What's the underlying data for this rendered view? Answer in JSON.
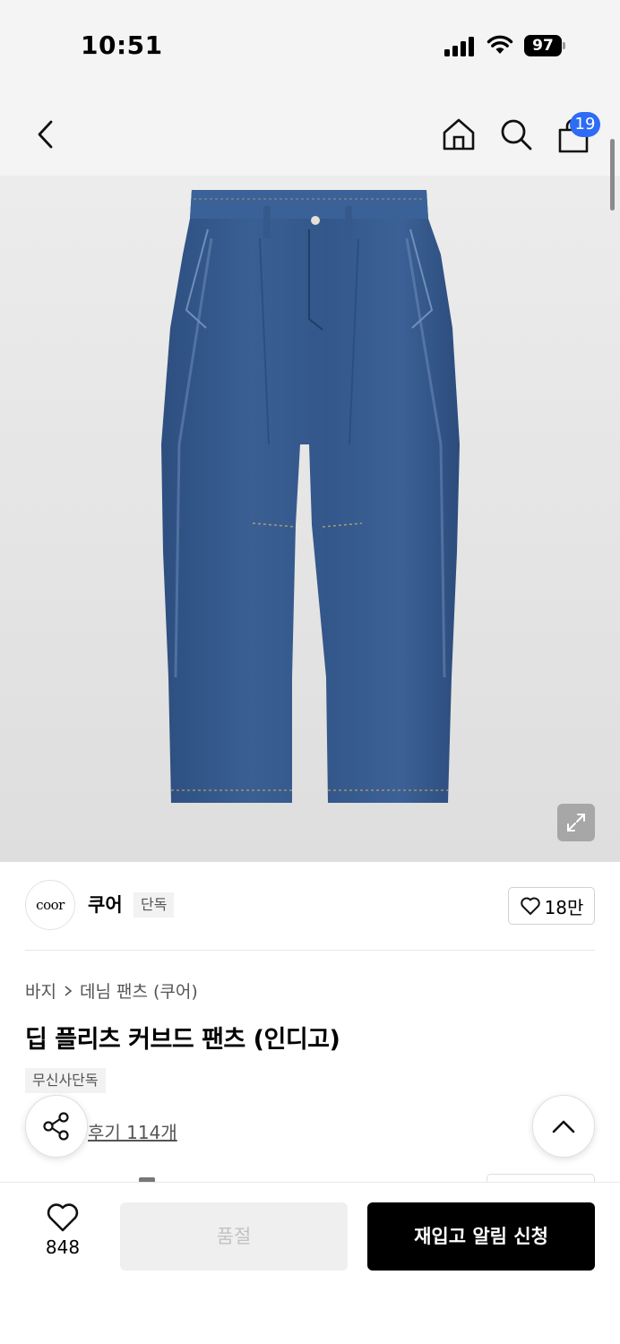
{
  "status_bar": {
    "time": "10:51",
    "battery": "97"
  },
  "nav": {
    "cart_count": "19"
  },
  "brand": {
    "logo_text": "coor",
    "name": "쿠어",
    "tag": "단독",
    "likes": "18만"
  },
  "breadcrumb": {
    "category": "바지",
    "subcategory": "데님 팬츠 (쿠어)"
  },
  "product": {
    "title": "딥 플리츠 커브드 팬츠 (인디고)",
    "exclusive_tag": "무신사단독",
    "reviews": "후기 114개"
  },
  "bottom_bar": {
    "wish_count": "848",
    "soldout_label": "품절",
    "restock_label": "재입고 알림 신청"
  },
  "colors": {
    "accent_badge": "#2e6cf6",
    "primary_button": "#000000",
    "denim": "#35598c"
  }
}
